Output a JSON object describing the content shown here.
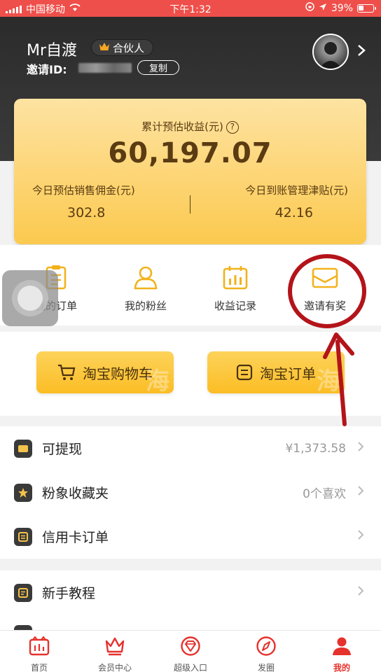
{
  "status_bar": {
    "carrier": "中国移动",
    "time": "下午1:32",
    "battery": "39%"
  },
  "profile": {
    "username": "Mr自渡",
    "badge": "合伙人",
    "invite_label": "邀请ID:",
    "copy_label": "复制"
  },
  "earnings": {
    "title": "累计预估收益(元)",
    "total": "60,197.07",
    "today_commission_label": "今日预估销售佣金(元)",
    "today_commission_value": "302.8",
    "today_subsidy_label": "今日到账管理津贴(元)",
    "today_subsidy_value": "42.16"
  },
  "quick_menu": [
    {
      "label": "我的订单",
      "icon": "clipboard-icon"
    },
    {
      "label": "我的粉丝",
      "icon": "user-icon"
    },
    {
      "label": "收益记录",
      "icon": "calendar-chart-icon"
    },
    {
      "label": "邀请有奖",
      "icon": "envelope-icon"
    }
  ],
  "taobao": {
    "cart_label": "淘宝购物车",
    "orders_label": "淘宝订单",
    "watermark": "海"
  },
  "list": {
    "withdraw_label": "可提现",
    "withdraw_value": "¥1,373.58",
    "favorites_label": "粉象收藏夹",
    "favorites_value": "0个喜欢",
    "credit_label": "信用卡订单",
    "tutorial_label": "新手教程"
  },
  "tabs": [
    {
      "label": "首页",
      "icon": "home-icon"
    },
    {
      "label": "会员中心",
      "icon": "crown-icon"
    },
    {
      "label": "超级入口",
      "icon": "diamond-icon"
    },
    {
      "label": "发圈",
      "icon": "compass-icon"
    },
    {
      "label": "我的",
      "icon": "person-icon"
    }
  ],
  "colors": {
    "status_bar": "#ee4f4a",
    "accent": "#fbc94e",
    "active_tab": "#e5322d",
    "annotation": "#b3141a"
  }
}
